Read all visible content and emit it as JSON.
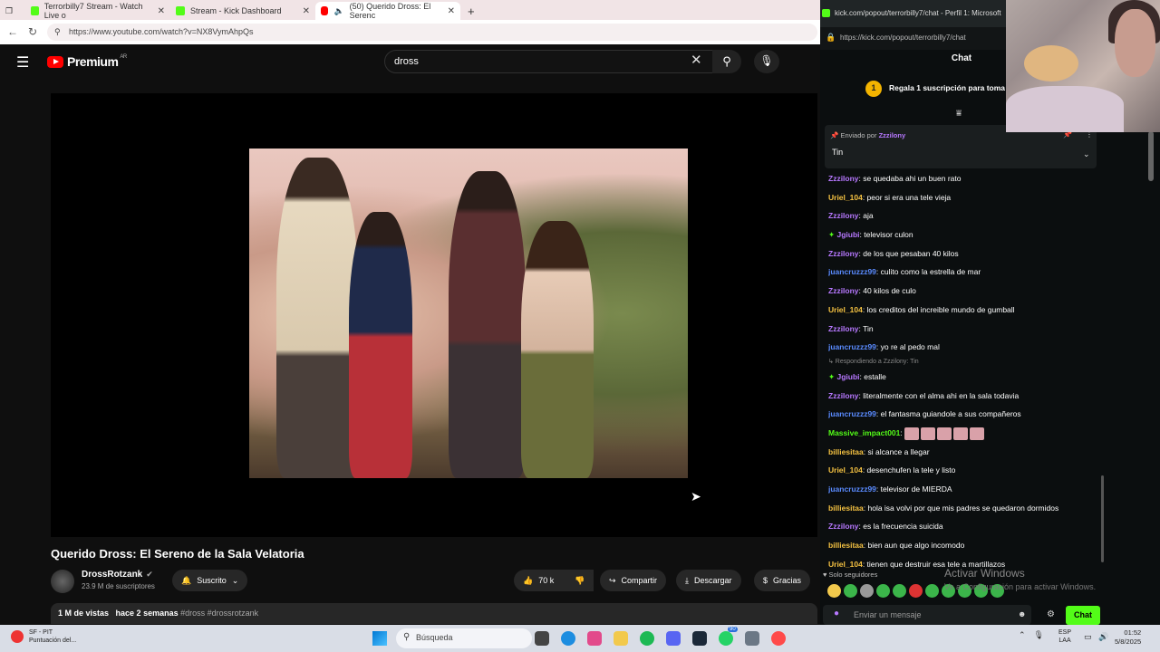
{
  "browser": {
    "tabs": [
      {
        "label": "Terrorbilly7 Stream - Watch Live o",
        "icon": "kick-icon"
      },
      {
        "label": "Stream - Kick Dashboard",
        "icon": "kick-icon"
      },
      {
        "label": "(50) Querido Dross: El Serenc",
        "icon": "youtube-icon"
      }
    ],
    "url": "https://www.youtube.com/watch?v=NX8VymAhpQs"
  },
  "youtube": {
    "logo_text": "Premium",
    "region": "AR",
    "search_value": "dross",
    "video_title": "Querido Dross: El Sereno de la Sala Velatoria",
    "channel_name": "DrossRotzank",
    "subscribers": "23.9 M de suscriptores",
    "subscribed_label": "Suscrito",
    "likes": "70 k",
    "share_label": "Compartir",
    "download_label": "Descargar",
    "thanks_label": "Gracias",
    "views": "1 M de vistas",
    "age": "hace 2 semanas",
    "hashtags": "#dross #drossrotzank"
  },
  "kick": {
    "window_title": "kick.com/popout/terrorbilly7/chat - Perfil 1: Microsoft",
    "url": "https://kick.com/popout/terrorbilly7/chat",
    "chat_header": "Chat",
    "gift_count": "1",
    "gift_text": "Regala 1 suscripción para toma",
    "pinned_by_label": "Enviado por",
    "pinned_by_user": "Zzzilony",
    "pinned_message": "Tin",
    "messages": [
      {
        "user": "Zzzilony",
        "text": "se quedaba ahi un buen rato",
        "color": "#b778ff"
      },
      {
        "user": "Uriel_104",
        "text": "peor si era una tele vieja",
        "color": "#f5c242"
      },
      {
        "user": "Zzzilony",
        "text": "aja",
        "color": "#b778ff"
      },
      {
        "user": "Jgiubi",
        "text": "televisor culon",
        "color": "#b778ff",
        "badge": true
      },
      {
        "user": "Zzzilony",
        "text": "de los que pesaban 40 kilos",
        "color": "#b778ff"
      },
      {
        "user": "juancruzzz99",
        "text": "culito como la estrella de mar",
        "color": "#5a8bff"
      },
      {
        "user": "Zzzilony",
        "text": "40 kilos de culo",
        "color": "#b778ff"
      },
      {
        "user": "Uriel_104",
        "text": "los creditos del increible mundo de gumball",
        "color": "#f5c242"
      },
      {
        "user": "Zzzilony",
        "text": "Tin",
        "color": "#b778ff"
      },
      {
        "user": "juancruzzz99",
        "text": "yo re al pedo mal",
        "color": "#5a8bff"
      },
      {
        "reply": "Respondiendo a Zzzilony: Tin"
      },
      {
        "user": "Jgiubi",
        "text": "estalle",
        "color": "#b778ff",
        "badge": true
      },
      {
        "user": "Zzzilony",
        "text": "literalmente con el alma ahi en la sala todavia",
        "color": "#b778ff"
      },
      {
        "user": "juancruzzz99",
        "text": "el fantasma guiandole a sus compañeros",
        "color": "#5a8bff"
      },
      {
        "user": "Massive_impact001",
        "text": "",
        "color": "#53fc18",
        "emotes": 5
      },
      {
        "user": "billiesitaa",
        "text": "si alcance a llegar",
        "color": "#f5c242"
      },
      {
        "user": "Uriel_104",
        "text": "desenchufen la tele y listo",
        "color": "#f5c242"
      },
      {
        "user": "juancruzzz99",
        "text": "televisor de MIERDA",
        "color": "#5a8bff"
      },
      {
        "user": "billiesitaa",
        "text": "hola isa volvi por que mis padres se quedaron dormidos",
        "color": "#f5c242"
      },
      {
        "user": "Zzzilony",
        "text": "es la frecuencia suicida",
        "color": "#b778ff"
      },
      {
        "user": "billiesitaa",
        "text": "bien aun que algo incomodo",
        "color": "#f5c242"
      },
      {
        "user": "Uriel_104",
        "text": "tienen que destruir esa tele a martillazos",
        "color": "#f5c242"
      }
    ],
    "followers_only": "Solo seguidores",
    "activate_title": "Activar Windows",
    "activate_sub": "Ve a Configuración para activar Windows.",
    "input_placeholder": "Enviar un mensaje",
    "send_label": "Chat"
  },
  "taskbar": {
    "weather_title": "SF - PIT",
    "weather_sub": "Puntuación del...",
    "search_label": "Búsqueda",
    "lang_top": "ESP",
    "lang_bottom": "LAA",
    "time": "01:52",
    "date": "5/8/2025",
    "badge_count": "90"
  }
}
